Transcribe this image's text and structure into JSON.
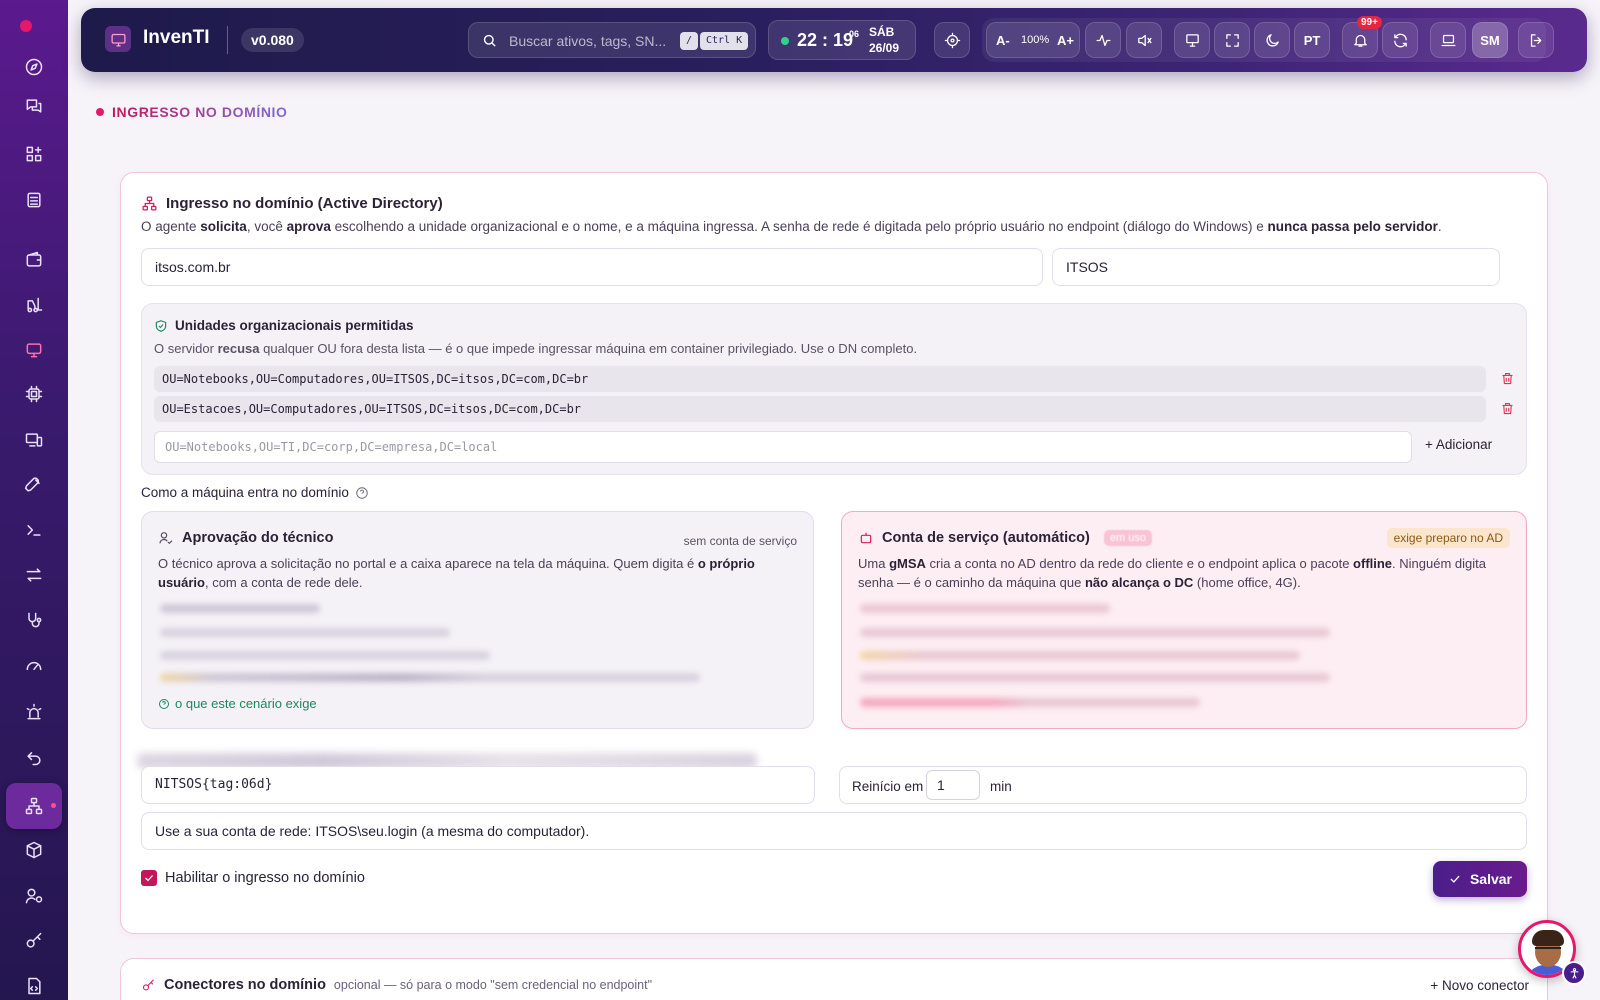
{
  "app": {
    "brand": "InvenTI",
    "version": "v0.080"
  },
  "topbar": {
    "search_placeholder": "Buscar ativos, tags, SN...",
    "search_shortcut_1": "/",
    "search_shortcut_2": "Ctrl K",
    "clock_time": "22 : 19",
    "clock_seconds": "06",
    "clock_day": "SÁB",
    "clock_date": "26/09",
    "zoom_dec": "A-",
    "zoom_level": "100%",
    "zoom_inc": "A+",
    "language": "PT",
    "notifications_badge": "99+",
    "user_initials": "SM"
  },
  "breadcrumb": {
    "title": "INGRESSO NO DOMÍNIO"
  },
  "domain_join": {
    "title": "Ingresso no domínio (Active Directory)",
    "desc_1": "O agente ",
    "desc_2": "solicita",
    "desc_3": ", você ",
    "desc_4": "aprova",
    "desc_5": " escolhendo a unidade organizacional e o nome, e a máquina ingressa. A senha de rede é digitada pelo próprio usuário no endpoint (diálogo do Windows) e ",
    "desc_6": "nunca passa pelo servidor",
    "desc_7": ".",
    "domain_fqdn": "itsos.com.br",
    "domain_netbios": "ITSOS",
    "ou": {
      "title": "Unidades organizacionais permitidas",
      "desc_1": "O servidor ",
      "desc_2": "recusa",
      "desc_3": " qualquer OU fora desta lista — é o que impede ingressar máquina em container privilegiado. Use o DN completo.",
      "items": [
        "OU=Notebooks,OU=Computadores,OU=ITSOS,DC=itsos,DC=com,DC=br",
        "OU=Estacoes,OU=Computadores,OU=ITSOS,DC=itsos,DC=com,DC=br"
      ],
      "input_placeholder": "OU=Notebooks,OU=TI,DC=corp,DC=empresa,DC=local",
      "add_label": "+ Adicionar"
    },
    "mode_label": "Como a máquina entra no domínio",
    "tech": {
      "title": "Aprovação do técnico",
      "right": "sem conta de serviço",
      "desc_1": "O técnico aprova a solicitação no portal e a caixa aparece na tela da máquina. Quem digita é ",
      "desc_2": "o próprio usuário",
      "desc_3": ", com a conta de rede dele.",
      "help": "o que este cenário exige"
    },
    "svc": {
      "title": "Conta de serviço (automático)",
      "tag": "em uso",
      "prep": "exige preparo no AD",
      "desc_1": "Uma ",
      "desc_2": "gMSA",
      "desc_3": " cria a conta no AD dentro da rede do cliente e o endpoint aplica o pacote ",
      "desc_4": "offline",
      "desc_5": ". Ninguém digita senha — é o caminho da máquina que ",
      "desc_6": "não alcança o DC",
      "desc_7": " (home office, 4G)."
    },
    "name_template": "NITSOS{tag:06d}",
    "restart_label": "Reinício em",
    "restart_value": "1",
    "restart_unit": "min",
    "message": "Use a sua conta de rede: ITSOS\\seu.login (a mesma do computador).",
    "enable_label": "Habilitar o ingresso no domínio",
    "enable_checked": true,
    "save_label": "Salvar"
  },
  "connectors": {
    "title": "Conectores no domínio",
    "optional": "opcional — só para o modo \"sem credencial no endpoint\"",
    "new_label": "+ Novo conector"
  },
  "colors": {
    "accent": "#e5186b",
    "primary": "#4a1e8a",
    "success": "#1b8a5a"
  }
}
